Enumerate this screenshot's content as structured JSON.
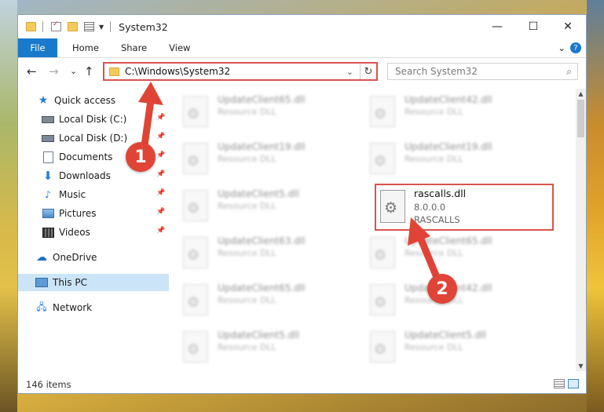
{
  "window": {
    "title": "System32",
    "controls": {
      "minimize": "—",
      "maximize": "☐",
      "close": "✕"
    }
  },
  "ribbon": {
    "tabs": [
      "File",
      "Home",
      "Share",
      "View"
    ],
    "help": "?"
  },
  "navigation": {
    "back": "←",
    "forward": "→",
    "recent": "⌄",
    "up": "↑"
  },
  "address": {
    "path": "C:\\Windows\\System32",
    "dropdown": "⌄",
    "refresh": "↻"
  },
  "search": {
    "placeholder": "Search System32",
    "icon": "⌕"
  },
  "sidebar": {
    "items": [
      {
        "label": "Quick access",
        "icon": "star-icon"
      },
      {
        "label": "Local Disk (C:)",
        "icon": "drive-icon",
        "pinned": true
      },
      {
        "label": "Local Disk (D:)",
        "icon": "drive-icon",
        "pinned": true
      },
      {
        "label": "Documents",
        "icon": "documents-icon",
        "pinned": true
      },
      {
        "label": "Downloads",
        "icon": "download-icon",
        "pinned": true
      },
      {
        "label": "Music",
        "icon": "music-icon",
        "pinned": true
      },
      {
        "label": "Pictures",
        "icon": "pictures-icon",
        "pinned": true
      },
      {
        "label": "Videos",
        "icon": "videos-icon",
        "pinned": true
      },
      {
        "label": "OneDrive",
        "icon": "cloud-icon"
      },
      {
        "label": "This PC",
        "icon": "computer-icon",
        "selected": true
      },
      {
        "label": "Network",
        "icon": "network-icon"
      }
    ],
    "pin_glyph": "📌"
  },
  "files": {
    "type_label": "Resource DLL",
    "items": [
      {
        "name": "UpdateClient65.dll"
      },
      {
        "name": "UpdateClient42.dll"
      },
      {
        "name": "UpdateClient19.dll"
      },
      {
        "name": "UpdateClient19.dll"
      },
      {
        "name": "UpdateClient5.dll"
      },
      {
        "name": "UpdateClient63.dll"
      },
      {
        "name": "UpdateClient65.dll"
      },
      {
        "name": "UpdateClient65.dll"
      },
      {
        "name": "UpdateClient42.dll"
      },
      {
        "name": "UpdateClient5.dll"
      },
      {
        "name": "UpdateClient5.dll"
      }
    ],
    "highlighted": {
      "name": "rascalls.dll",
      "version": "8.0.0.0",
      "description": "RASCALLS"
    }
  },
  "status": {
    "item_count": "146 items"
  },
  "annotations": {
    "step1": "1",
    "step2": "2",
    "color": "#e04437"
  },
  "colors": {
    "accent": "#1979ca",
    "highlight_border": "#d9534f",
    "selection": "#cce4f7"
  }
}
